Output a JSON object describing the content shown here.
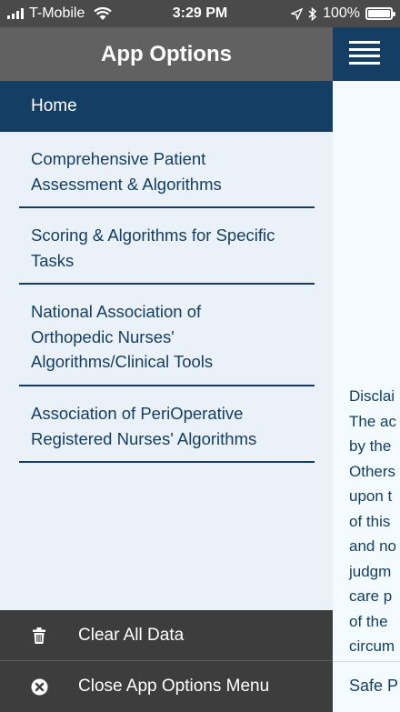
{
  "status_bar": {
    "carrier": "T-Mobile",
    "time": "3:29 PM",
    "battery": "100%",
    "battery_level": 1.0,
    "icons": [
      "signal-bars-icon",
      "wifi-icon",
      "location-arrow-icon",
      "bluetooth-icon",
      "battery-icon"
    ]
  },
  "drawer": {
    "title": "App Options",
    "home": "Home",
    "items": [
      {
        "line1": "Comprehensive Patient",
        "line2": "Assessment & Algorithms",
        "line3": ""
      },
      {
        "line1": "Scoring & Algorithms for Specific",
        "line2": "Tasks",
        "line3": ""
      },
      {
        "line1": "National Association of",
        "line2": "Orthopedic Nurses'",
        "line3": "Algorithms/Clinical Tools"
      },
      {
        "line1": "Association of PeriOperative",
        "line2": "Registered Nurses' Algorithms",
        "line3": ""
      }
    ],
    "clear_label": "Clear All Data",
    "close_label": "Close App Options Menu"
  },
  "background_page": {
    "menu_icon": "hamburger-menu-icon",
    "lines": [
      "Disclai",
      "The ac",
      "by the",
      "Others",
      "upon t",
      "of this",
      "and no",
      "judgm",
      "care p",
      "of the",
      "circum"
    ],
    "footer": "Safe P"
  },
  "colors": {
    "navy": "#143e63",
    "drawer_bg": "#eaf1f8",
    "drawer_title_bg": "#616161",
    "bottom_bar_bg": "#3d3d3d"
  }
}
